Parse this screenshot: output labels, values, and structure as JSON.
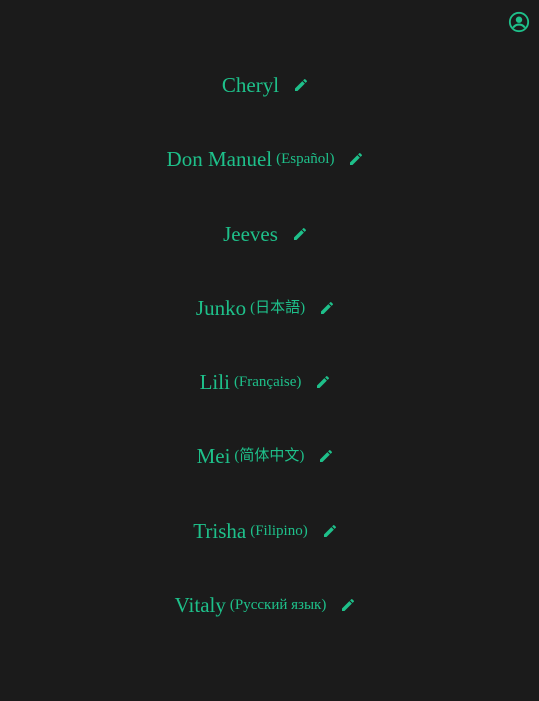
{
  "colors": {
    "background": "#1b1b1b",
    "accent": "#1ec08a"
  },
  "header": {
    "account_icon": "account-circle-icon"
  },
  "voices": [
    {
      "name": "Cheryl",
      "language": ""
    },
    {
      "name": "Don Manuel",
      "language": "(Español)"
    },
    {
      "name": "Jeeves",
      "language": ""
    },
    {
      "name": "Junko",
      "language": "(日本語)"
    },
    {
      "name": "Lili",
      "language": "(Française)"
    },
    {
      "name": "Mei",
      "language": "(简体中文)"
    },
    {
      "name": "Trisha",
      "language": "(Filipino)"
    },
    {
      "name": "Vitaly",
      "language": "(Русский язык)"
    }
  ],
  "edit_icon": "pencil-icon"
}
